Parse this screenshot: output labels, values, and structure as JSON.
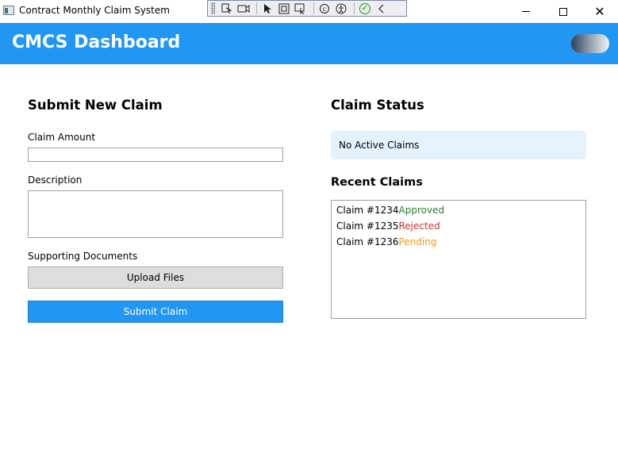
{
  "window": {
    "title": "Contract Monthly Claim System",
    "minimize_glyph": "",
    "close_glyph": "✕"
  },
  "debug_toolbar": {
    "icons": [
      "select-element-icon",
      "video-icon",
      "pointer-icon",
      "display-layout-adorners-icon",
      "track-focus-icon",
      "hot-reload-icon",
      "accessibility-icon",
      "binding-check-icon",
      "collapse-icon"
    ]
  },
  "header": {
    "title": "CMCS Dashboard",
    "bg_color": "#2196F3"
  },
  "submit_form": {
    "heading": "Submit New Claim",
    "claim_amount_label": "Claim Amount",
    "claim_amount_value": "",
    "description_label": "Description",
    "description_value": "",
    "documents_label": "Supporting Documents",
    "upload_button": "Upload Files",
    "submit_button": "Submit Claim"
  },
  "claim_status": {
    "heading": "Claim Status",
    "status_text": "No Active Claims",
    "box_color": "#E3F2FD"
  },
  "recent_claims": {
    "heading": "Recent Claims",
    "items": [
      {
        "claim": "Claim #1234",
        "status": "Approved",
        "status_color": "#2E7D32"
      },
      {
        "claim": "Claim #1235",
        "status": "Rejected",
        "status_color": "#D32F2F"
      },
      {
        "claim": "Claim #1236",
        "status": "Pending",
        "status_color": "#F39C12"
      }
    ]
  }
}
